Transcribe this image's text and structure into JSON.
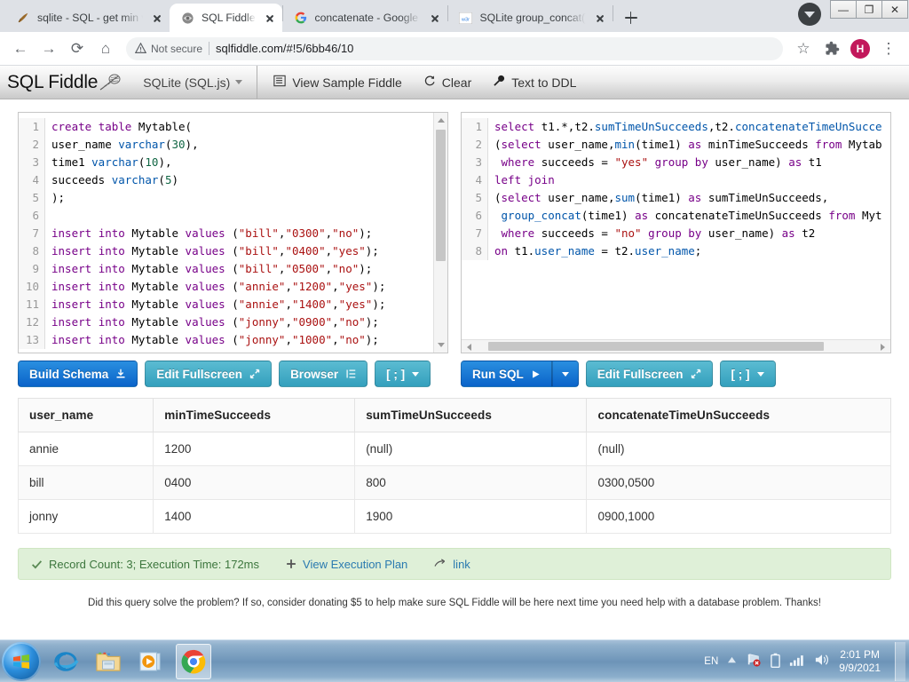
{
  "browser": {
    "tabs": [
      {
        "title": "sqlite - SQL - get min valu",
        "favicon": "sqlite-icon",
        "active": false
      },
      {
        "title": "SQL Fiddle",
        "favicon": "sqlfiddle-icon",
        "active": true
      },
      {
        "title": "concatenate - Google Sea",
        "favicon": "google-icon",
        "active": false
      },
      {
        "title": "SQLite group_concat() fun",
        "favicon": "w3schools-icon",
        "active": false
      }
    ],
    "new_tab_label": "+",
    "window_controls": {
      "minimize": "—",
      "maximize": "❐",
      "close": "✕"
    },
    "nav": {
      "back": "←",
      "forward": "→",
      "reload": "⟳",
      "home": "⌂"
    },
    "omnibox": {
      "security_label": "Not secure",
      "url": "sqlfiddle.com/#!5/6bb46/10"
    },
    "toolbar_right": {
      "bookmark": "☆",
      "extensions": "puzzle-icon",
      "avatar": "H",
      "menu": "⋮"
    }
  },
  "sqlfiddle": {
    "brand": "SQL Fiddle",
    "db_select": "SQLite (SQL.js)",
    "menu": [
      {
        "label": "View Sample Fiddle",
        "icon": "list-icon"
      },
      {
        "label": "Clear",
        "icon": "refresh-icon"
      },
      {
        "label": "Text to DDL",
        "icon": "wrench-icon"
      }
    ],
    "schema_editor": {
      "lines": [
        {
          "n": "1",
          "tokens": [
            [
              "k",
              "create "
            ],
            [
              "k",
              "table "
            ],
            [
              "op",
              "Mytable("
            ]
          ]
        },
        {
          "n": "2",
          "tokens": [
            [
              "op",
              "user_name "
            ],
            [
              "var",
              "varchar"
            ],
            [
              "op",
              "("
            ],
            [
              "num",
              "30"
            ],
            [
              "op",
              "),"
            ]
          ]
        },
        {
          "n": "3",
          "tokens": [
            [
              "op",
              "time1 "
            ],
            [
              "var",
              "varchar"
            ],
            [
              "op",
              "("
            ],
            [
              "num",
              "10"
            ],
            [
              "op",
              "),"
            ]
          ]
        },
        {
          "n": "4",
          "tokens": [
            [
              "op",
              "succeeds "
            ],
            [
              "var",
              "varchar"
            ],
            [
              "op",
              "("
            ],
            [
              "num",
              "5"
            ],
            [
              "op",
              ")"
            ]
          ]
        },
        {
          "n": "5",
          "tokens": [
            [
              "op",
              ");"
            ]
          ]
        },
        {
          "n": "6",
          "tokens": [
            [
              "op",
              ""
            ]
          ]
        },
        {
          "n": "7",
          "tokens": [
            [
              "k",
              "insert "
            ],
            [
              "k",
              "into "
            ],
            [
              "op",
              "Mytable "
            ],
            [
              "k",
              "values "
            ],
            [
              "op",
              "("
            ],
            [
              "str",
              "\"bill\""
            ],
            [
              "op",
              ","
            ],
            [
              "str",
              "\"0300\""
            ],
            [
              "op",
              ","
            ],
            [
              "str",
              "\"no\""
            ],
            [
              "op",
              ");"
            ]
          ]
        },
        {
          "n": "8",
          "tokens": [
            [
              "k",
              "insert "
            ],
            [
              "k",
              "into "
            ],
            [
              "op",
              "Mytable "
            ],
            [
              "k",
              "values "
            ],
            [
              "op",
              "("
            ],
            [
              "str",
              "\"bill\""
            ],
            [
              "op",
              ","
            ],
            [
              "str",
              "\"0400\""
            ],
            [
              "op",
              ","
            ],
            [
              "str",
              "\"yes\""
            ],
            [
              "op",
              ");"
            ]
          ]
        },
        {
          "n": "9",
          "tokens": [
            [
              "k",
              "insert "
            ],
            [
              "k",
              "into "
            ],
            [
              "op",
              "Mytable "
            ],
            [
              "k",
              "values "
            ],
            [
              "op",
              "("
            ],
            [
              "str",
              "\"bill\""
            ],
            [
              "op",
              ","
            ],
            [
              "str",
              "\"0500\""
            ],
            [
              "op",
              ","
            ],
            [
              "str",
              "\"no\""
            ],
            [
              "op",
              ");"
            ]
          ]
        },
        {
          "n": "10",
          "tokens": [
            [
              "k",
              "insert "
            ],
            [
              "k",
              "into "
            ],
            [
              "op",
              "Mytable "
            ],
            [
              "k",
              "values "
            ],
            [
              "op",
              "("
            ],
            [
              "str",
              "\"annie\""
            ],
            [
              "op",
              ","
            ],
            [
              "str",
              "\"1200\""
            ],
            [
              "op",
              ","
            ],
            [
              "str",
              "\"yes\""
            ],
            [
              "op",
              ");"
            ]
          ]
        },
        {
          "n": "11",
          "tokens": [
            [
              "k",
              "insert "
            ],
            [
              "k",
              "into "
            ],
            [
              "op",
              "Mytable "
            ],
            [
              "k",
              "values "
            ],
            [
              "op",
              "("
            ],
            [
              "str",
              "\"annie\""
            ],
            [
              "op",
              ","
            ],
            [
              "str",
              "\"1400\""
            ],
            [
              "op",
              ","
            ],
            [
              "str",
              "\"yes\""
            ],
            [
              "op",
              ");"
            ]
          ]
        },
        {
          "n": "12",
          "tokens": [
            [
              "k",
              "insert "
            ],
            [
              "k",
              "into "
            ],
            [
              "op",
              "Mytable "
            ],
            [
              "k",
              "values "
            ],
            [
              "op",
              "("
            ],
            [
              "str",
              "\"jonny\""
            ],
            [
              "op",
              ","
            ],
            [
              "str",
              "\"0900\""
            ],
            [
              "op",
              ","
            ],
            [
              "str",
              "\"no\""
            ],
            [
              "op",
              ");"
            ]
          ]
        },
        {
          "n": "13",
          "tokens": [
            [
              "k",
              "insert "
            ],
            [
              "k",
              "into "
            ],
            [
              "op",
              "Mytable "
            ],
            [
              "k",
              "values "
            ],
            [
              "op",
              "("
            ],
            [
              "str",
              "\"jonny\""
            ],
            [
              "op",
              ","
            ],
            [
              "str",
              "\"1000\""
            ],
            [
              "op",
              ","
            ],
            [
              "str",
              "\"no\""
            ],
            [
              "op",
              ");"
            ]
          ]
        }
      ],
      "buttons": [
        {
          "label": "Build Schema",
          "icon": "download-icon",
          "style": "blue"
        },
        {
          "label": "Edit Fullscreen",
          "icon": "expand-icon",
          "style": "teal"
        },
        {
          "label": "Browser",
          "icon": "indent-icon",
          "style": "teal"
        },
        {
          "label": "[ ; ]",
          "icon": "caret-down-icon",
          "style": "teal"
        }
      ]
    },
    "query_editor": {
      "lines": [
        {
          "n": "1",
          "tokens": [
            [
              "k",
              "select "
            ],
            [
              "op",
              "t1.*,t2."
            ],
            [
              "var",
              "sumTimeUnSucceeds"
            ],
            [
              "op",
              ",t2."
            ],
            [
              "var",
              "concatenateTimeUnSucce"
            ]
          ]
        },
        {
          "n": "2",
          "tokens": [
            [
              "op",
              "("
            ],
            [
              "k",
              "select "
            ],
            [
              "op",
              "user_name,"
            ],
            [
              "var",
              "min"
            ],
            [
              "op",
              "(time1) "
            ],
            [
              "k",
              "as "
            ],
            [
              "op",
              "minTimeSucceeds "
            ],
            [
              "k",
              "from "
            ],
            [
              "op",
              "Mytab"
            ]
          ]
        },
        {
          "n": "3",
          "tokens": [
            [
              "op",
              " "
            ],
            [
              "k",
              "where "
            ],
            [
              "op",
              "succeeds = "
            ],
            [
              "str",
              "\"yes\""
            ],
            [
              "op",
              " "
            ],
            [
              "k",
              "group by "
            ],
            [
              "op",
              "user_name) "
            ],
            [
              "k",
              "as "
            ],
            [
              "op",
              "t1"
            ]
          ]
        },
        {
          "n": "4",
          "tokens": [
            [
              "k",
              "left join"
            ]
          ]
        },
        {
          "n": "5",
          "tokens": [
            [
              "op",
              "("
            ],
            [
              "k",
              "select "
            ],
            [
              "op",
              "user_name,"
            ],
            [
              "var",
              "sum"
            ],
            [
              "op",
              "(time1) "
            ],
            [
              "k",
              "as "
            ],
            [
              "op",
              "sumTimeUnSucceeds,"
            ]
          ]
        },
        {
          "n": "6",
          "tokens": [
            [
              "op",
              " "
            ],
            [
              "var",
              "group_concat"
            ],
            [
              "op",
              "(time1) "
            ],
            [
              "k",
              "as "
            ],
            [
              "op",
              "concatenateTimeUnSucceeds "
            ],
            [
              "k",
              "from "
            ],
            [
              "op",
              "Myt"
            ]
          ]
        },
        {
          "n": "7",
          "tokens": [
            [
              "op",
              " "
            ],
            [
              "k",
              "where "
            ],
            [
              "op",
              "succeeds = "
            ],
            [
              "str",
              "\"no\""
            ],
            [
              "op",
              " "
            ],
            [
              "k",
              "group by "
            ],
            [
              "op",
              "user_name) "
            ],
            [
              "k",
              "as "
            ],
            [
              "op",
              "t2"
            ]
          ]
        },
        {
          "n": "8",
          "tokens": [
            [
              "k",
              "on "
            ],
            [
              "op",
              "t1."
            ],
            [
              "var",
              "user_name"
            ],
            [
              "op",
              " = t2."
            ],
            [
              "var",
              "user_name"
            ],
            [
              "op",
              ";"
            ]
          ]
        }
      ],
      "buttons": [
        {
          "label": "Run SQL",
          "icon": "play-icon",
          "style": "blue"
        },
        {
          "label": "",
          "icon": "caret-down-icon",
          "style": "blue"
        },
        {
          "label": "Edit Fullscreen",
          "icon": "expand-icon",
          "style": "teal"
        },
        {
          "label": "[ ; ]",
          "icon": "caret-down-icon",
          "style": "teal"
        }
      ]
    },
    "results": {
      "columns": [
        "user_name",
        "minTimeSucceeds",
        "sumTimeUnSucceeds",
        "concatenateTimeUnSucceeds"
      ],
      "rows": [
        [
          "annie",
          "1200",
          "(null)",
          "(null)"
        ],
        [
          "bill",
          "0400",
          "800",
          "0300,0500"
        ],
        [
          "jonny",
          "1400",
          "1900",
          "0900,1000"
        ]
      ]
    },
    "status": {
      "check_icon": "check-icon",
      "text": "Record Count: 3; Execution Time: 172ms",
      "plan_icon": "plus-icon",
      "plan_label": "View Execution Plan",
      "link_icon": "arrow-icon",
      "link_label": "link"
    },
    "donate_note": "Did this query solve the problem? If so, consider donating $5 to help make sure SQL Fiddle will be here next time you need help with a database problem. Thanks!"
  },
  "taskbar": {
    "start": "start-orb-icon",
    "pinned": [
      {
        "name": "internet-explorer-icon",
        "active": false
      },
      {
        "name": "file-explorer-icon",
        "active": false
      },
      {
        "name": "media-player-icon",
        "active": false
      },
      {
        "name": "google-chrome-icon",
        "active": true
      }
    ],
    "tray": {
      "language": "EN",
      "show_hidden": "▲",
      "icons": [
        "network-error-icon",
        "battery-icon",
        "signal-icon",
        "volume-icon"
      ],
      "time": "2:01 PM",
      "date": "9/9/2021"
    }
  },
  "colors": {
    "chrome_tabstrip": "#dee1e6",
    "accent_blue": "#0a63c9",
    "accent_teal": "#34a0bd",
    "status_green_bg": "#dff0d8",
    "status_green_fg": "#3c763d",
    "avatar_pink": "#c2185b"
  }
}
